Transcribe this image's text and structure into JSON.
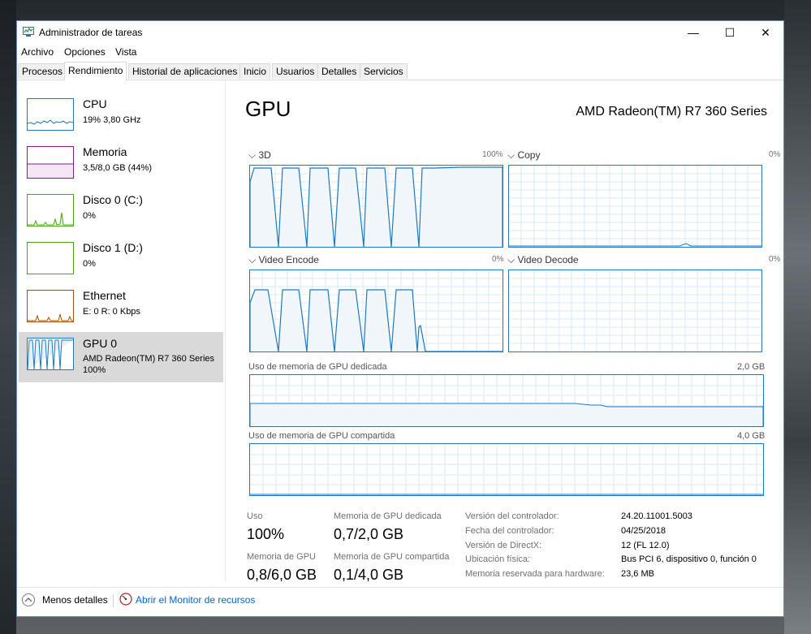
{
  "window": {
    "title": "Administrador de tareas",
    "controls": {
      "minimize": "—",
      "maximize": "☐",
      "close": "✕"
    }
  },
  "menu": [
    "Archivo",
    "Opciones",
    "Vista"
  ],
  "tabs": [
    "Procesos",
    "Rendimiento",
    "Historial de aplicaciones",
    "Inicio",
    "Usuarios",
    "Detalles",
    "Servicios"
  ],
  "active_tab": "Rendimiento",
  "sidebar": {
    "items": [
      {
        "name": "CPU",
        "sub1": "19% 3,80 GHz",
        "sub2": "",
        "color": "#1a7ac4"
      },
      {
        "name": "Memoria",
        "sub1": "3,5/8,0 GB (44%)",
        "sub2": "",
        "color": "#8b1a8b"
      },
      {
        "name": "Disco 0 (C:)",
        "sub1": "0%",
        "sub2": "",
        "color": "#4da60c"
      },
      {
        "name": "Disco 1 (D:)",
        "sub1": "0%",
        "sub2": "",
        "color": "#4da60c"
      },
      {
        "name": "Ethernet",
        "sub1": "E: 0 R: 0 Kbps",
        "sub2": "",
        "color": "#a74f01"
      },
      {
        "name": "GPU 0",
        "sub1": "AMD Radeon(TM) R7 360 Series",
        "sub2": "100%",
        "color": "#1a7ac4"
      }
    ],
    "selected_index": 5
  },
  "main": {
    "title": "GPU",
    "model": "AMD Radeon(TM) R7 360 Series",
    "engines": [
      {
        "label": "3D",
        "percent": "100%"
      },
      {
        "label": "Copy",
        "percent": "0%"
      },
      {
        "label": "Video Encode",
        "percent": "0%"
      },
      {
        "label": "Video Decode",
        "percent": "0%"
      }
    ],
    "dedicated_memory": {
      "label": "Uso de memoria de GPU dedicada",
      "max": "2,0 GB"
    },
    "shared_memory": {
      "label": "Uso de memoria de GPU compartida",
      "max": "4,0 GB"
    },
    "stats": {
      "usage": {
        "label": "Uso",
        "value": "100%"
      },
      "dedicated": {
        "label": "Memoria de GPU dedicada",
        "value": "0,7/2,0 GB"
      },
      "gpu_memory": {
        "label": "Memoria de GPU",
        "value": "0,8/6,0 GB"
      },
      "shared": {
        "label": "Memoria de GPU compartida",
        "value": "0,1/4,0 GB"
      }
    },
    "info": [
      {
        "label": "Versión del controlador:",
        "value": "24.20.11001.5003"
      },
      {
        "label": "Fecha del controlador:",
        "value": "04/25/2018"
      },
      {
        "label": "Versión de DirectX:",
        "value": "12 (FL 12.0)"
      },
      {
        "label": "Ubicación física:",
        "value": "Bus PCI 6, dispositivo 0, función 0"
      },
      {
        "label": "Memoria reservada para hardware:",
        "value": "23,6 MB"
      }
    ]
  },
  "footer": {
    "fewer_details": "Menos detalles",
    "resource_monitor": "Abrir el Monitor de recursos"
  },
  "colors": {
    "gpu": "#1a7ac4",
    "grid": "#d9eaf7",
    "fill": "#f1f6fb",
    "selected": "#d9d9d9"
  }
}
